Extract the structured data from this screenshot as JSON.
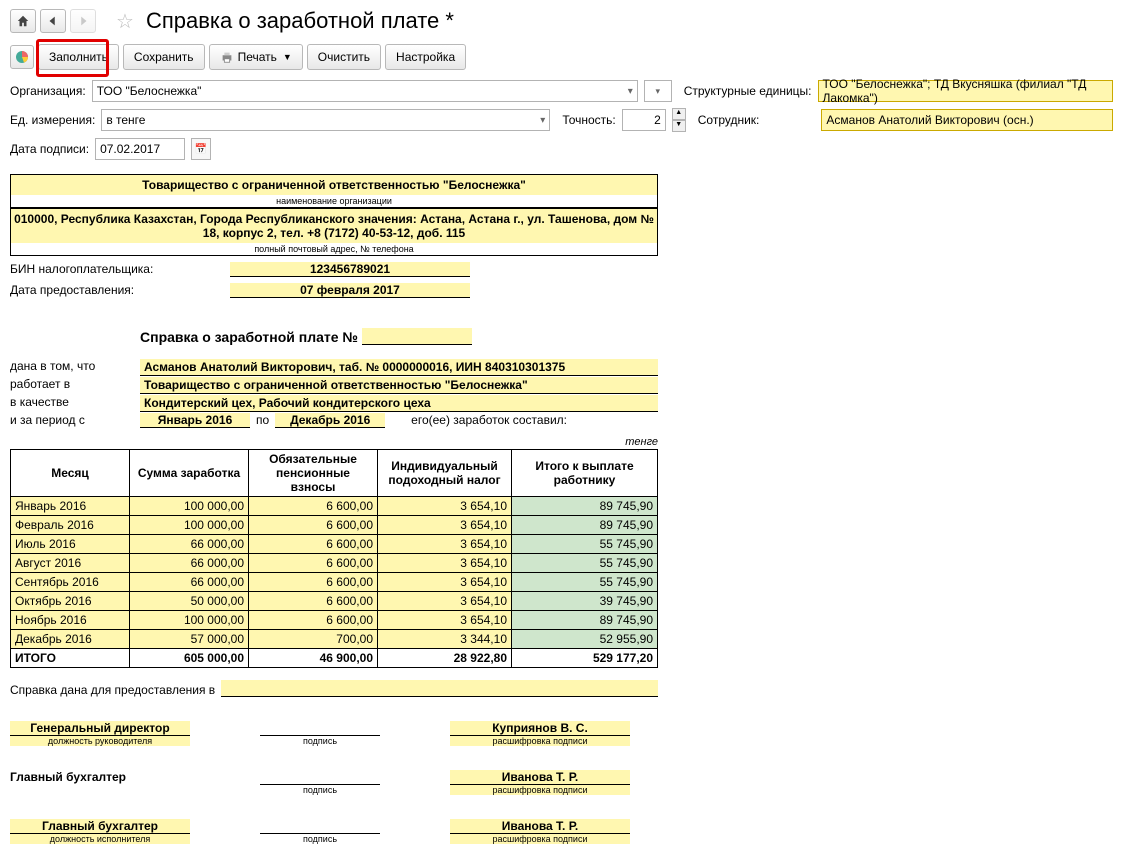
{
  "title": "Справка о заработной плате *",
  "toolbar": {
    "fill": "Заполнить",
    "save": "Сохранить",
    "print": "Печать",
    "clear": "Очистить",
    "setup": "Настройка"
  },
  "labels": {
    "org": "Организация:",
    "units": "Структурные единицы:",
    "measure": "Ед. измерения:",
    "precision": "Точность:",
    "employee": "Сотрудник:",
    "sign_date": "Дата подписи:"
  },
  "fields": {
    "org": "ТОО \"Белоснежка\"",
    "units": "ТОО \"Белоснежка\"; ТД Вкусняшка (филиал \"ТД Лакомка\")",
    "measure": "в тенге",
    "precision": "2",
    "employee": "Асманов Анатолий Викторович (осн.)",
    "sign_date": "07.02.2017"
  },
  "doc": {
    "orgname": "Товарищество с ограниченной ответственностью \"Белоснежка\"",
    "orgname_sub": "наименование организации",
    "address": "010000, Республика Казахстан, Города Республиканского значения: Астана, Астана г., ул. Ташенова, дом № 18, корпус 2, тел. +8 (7172) 40-53-12, доб. 115",
    "address_sub": "полный почтовый адрес, № телефона",
    "bin_label": "БИН налогоплательщика:",
    "bin": "123456789021",
    "date_label": "Дата предоставления:",
    "date": "07 февраля 2017",
    "spr_title": "Справка о заработной плате №",
    "given_that": "дана в том, что",
    "works_in": "работает в",
    "as_role": "в качестве",
    "for_period": "и за период с",
    "period_from": "Январь 2016",
    "period_to_lbl": "по",
    "period_to": "Декабрь 2016",
    "earn_text": "его(ее) заработок составил:",
    "person": "Асманов Анатолий Викторович, таб. № 0000000016, ИИН 840310301375",
    "employer": "Товарищество с ограниченной ответственностью \"Белоснежка\"",
    "position": "Кондитерский цех, Рабочий кондитерского цеха",
    "currency_note": "тенге",
    "purpose_label": "Справка дана для предоставления в",
    "sig": {
      "ceo_pos": "Генеральный директор",
      "ceo_pos_sub": "должность руководителя",
      "sign_sub": "подпись",
      "ceo_name": "Куприянов В. С.",
      "name_sub": "расшифровка подписи",
      "acc_pos": "Главный бухгалтер",
      "acc_name": "Иванова Т. Р.",
      "exec_pos": "Главный бухгалтер",
      "exec_pos_sub": "должность исполнителя",
      "exec_name": "Иванова Т. Р."
    }
  },
  "table": {
    "headers": {
      "month": "Месяц",
      "sum": "Сумма заработка",
      "pension": "Обязательные пенсионные взносы",
      "tax": "Индивидуальный подоходный налог",
      "pay": "Итого к выплате работнику"
    },
    "rows": [
      {
        "m": "Январь 2016",
        "s": "100 000,00",
        "p": "6 600,00",
        "t": "3 654,10",
        "o": "89 745,90"
      },
      {
        "m": "Февраль 2016",
        "s": "100 000,00",
        "p": "6 600,00",
        "t": "3 654,10",
        "o": "89 745,90"
      },
      {
        "m": "Июль 2016",
        "s": "66 000,00",
        "p": "6 600,00",
        "t": "3 654,10",
        "o": "55 745,90"
      },
      {
        "m": "Август 2016",
        "s": "66 000,00",
        "p": "6 600,00",
        "t": "3 654,10",
        "o": "55 745,90"
      },
      {
        "m": "Сентябрь 2016",
        "s": "66 000,00",
        "p": "6 600,00",
        "t": "3 654,10",
        "o": "55 745,90"
      },
      {
        "m": "Октябрь 2016",
        "s": "50 000,00",
        "p": "6 600,00",
        "t": "3 654,10",
        "o": "39 745,90"
      },
      {
        "m": "Ноябрь 2016",
        "s": "100 000,00",
        "p": "6 600,00",
        "t": "3 654,10",
        "o": "89 745,90"
      },
      {
        "m": "Декабрь 2016",
        "s": "57 000,00",
        "p": "700,00",
        "t": "3 344,10",
        "o": "52 955,90"
      }
    ],
    "total_label": "ИТОГО",
    "total": {
      "s": "605 000,00",
      "p": "46 900,00",
      "t": "28 922,80",
      "o": "529 177,20"
    }
  }
}
